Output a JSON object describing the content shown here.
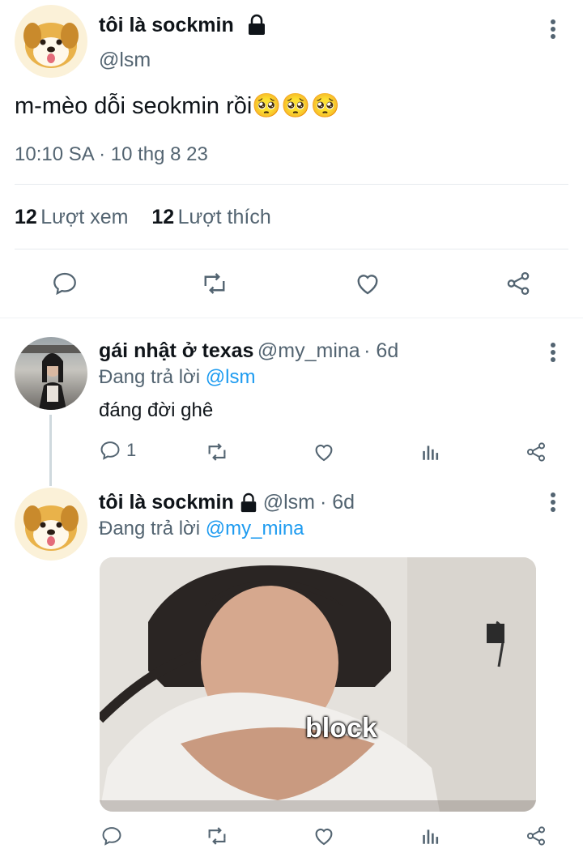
{
  "main_tweet": {
    "display_name": "tôi là sockmin",
    "handle": "@lsm",
    "text": "m-mèo dỗi seokmin rồi🥺🥺🥺",
    "timestamp": "10:10 SA · 10 thg 8 23",
    "views_count": "12",
    "views_label": "Lượt xem",
    "likes_count": "12",
    "likes_label": "Lượt thích",
    "icons": [
      "lock-icon",
      "more-icon",
      "reply-icon",
      "retweet-icon",
      "like-icon",
      "share-icon"
    ]
  },
  "reply1": {
    "display_name": "gái nhật ở texas",
    "handle": "@my_mina",
    "age": "· 6d",
    "reply_prefix": "Đang trả lời",
    "reply_to": "@lsm",
    "text": "đáng đời ghê",
    "reply_count": "1"
  },
  "reply2": {
    "display_name": "tôi là sockmin",
    "handle": "@lsm",
    "age": "· 6d",
    "reply_prefix": "Đang trả lời",
    "reply_to": "@my_mina",
    "media_caption": "block"
  },
  "colors": {
    "link": "#1d9bf0",
    "secondary_text": "#536471",
    "divider": "#e6ebee"
  }
}
